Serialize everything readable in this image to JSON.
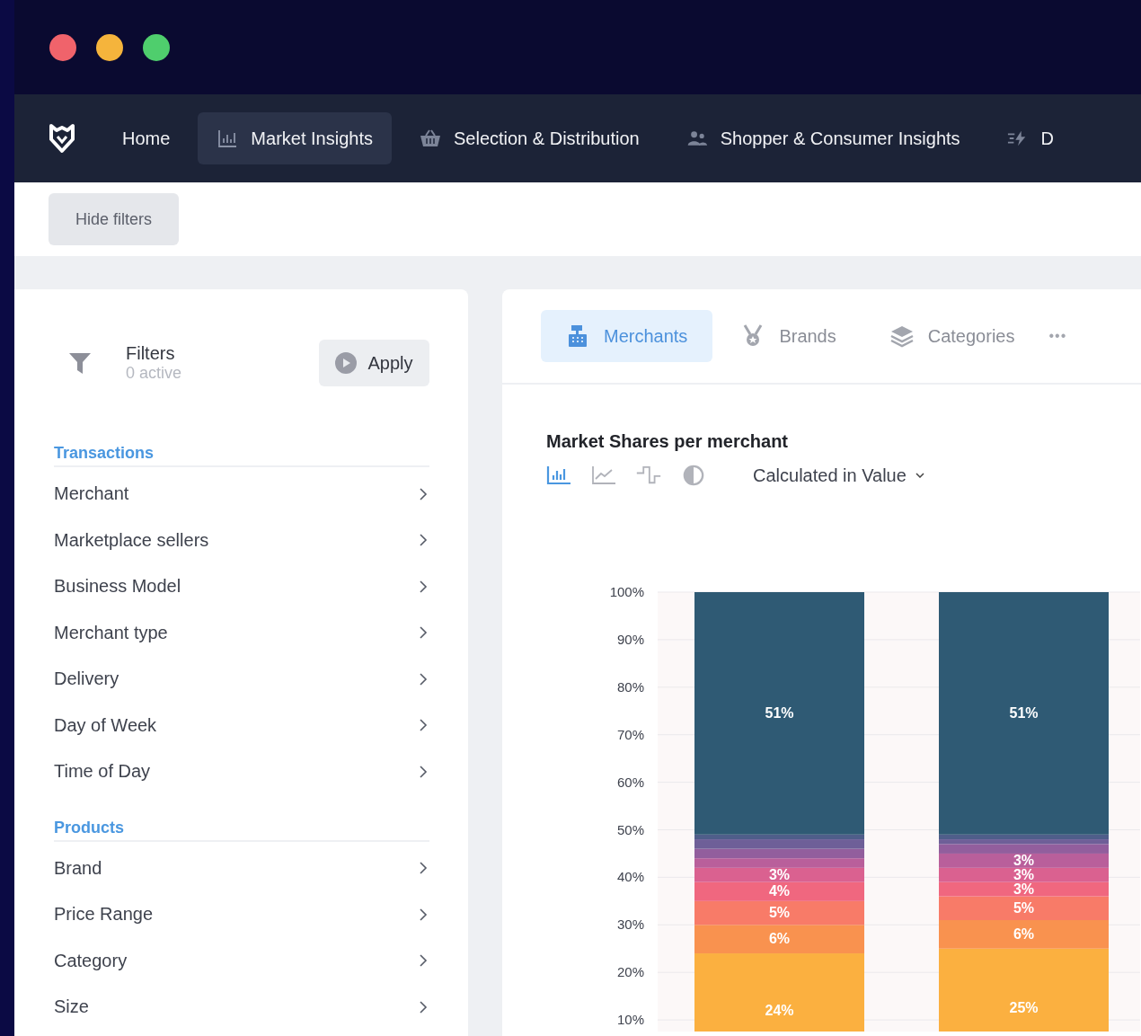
{
  "nav": {
    "items": [
      {
        "label": "Home",
        "selected": false
      },
      {
        "label": "Market Insights",
        "selected": true
      },
      {
        "label": "Selection & Distribution",
        "selected": false
      },
      {
        "label": "Shopper & Consumer Insights",
        "selected": false
      },
      {
        "label": "D",
        "selected": false
      }
    ]
  },
  "toolbar": {
    "hide_filters": "Hide filters"
  },
  "filters": {
    "title": "Filters",
    "count": "0 active",
    "apply": "Apply",
    "sections": [
      {
        "title": "Transactions",
        "items": [
          "Merchant",
          "Marketplace sellers",
          "Business Model",
          "Merchant type",
          "Delivery",
          "Day of Week",
          "Time of Day"
        ]
      },
      {
        "title": "Products",
        "items": [
          "Brand",
          "Price Range",
          "Category",
          "Size"
        ]
      }
    ]
  },
  "tabs": [
    {
      "label": "Merchants",
      "selected": true
    },
    {
      "label": "Brands",
      "selected": false
    },
    {
      "label": "Categories",
      "selected": false
    }
  ],
  "more_label": "•••",
  "panel": {
    "title": "Market Shares per merchant",
    "chart_types": [
      {
        "kind": "bar",
        "selected": true
      },
      {
        "kind": "line",
        "selected": false
      },
      {
        "kind": "step",
        "selected": false
      },
      {
        "kind": "contrast",
        "selected": false
      }
    ],
    "measure": "Calculated in Value",
    "chart_data": {
      "type": "bar",
      "stacked": true,
      "grid": true,
      "ylim": [
        0,
        100
      ],
      "yticks": [
        {
          "value": 10,
          "label": "10%"
        },
        {
          "value": 20,
          "label": "20%"
        },
        {
          "value": 30,
          "label": "30%"
        },
        {
          "value": 40,
          "label": "40%"
        },
        {
          "value": 50,
          "label": "50%"
        },
        {
          "value": 60,
          "label": "60%"
        },
        {
          "value": 70,
          "label": "70%"
        },
        {
          "value": 80,
          "label": "80%"
        },
        {
          "value": 90,
          "label": "90%"
        },
        {
          "value": 100,
          "label": "100%"
        }
      ],
      "series": [
        {
          "color": "#fbb040",
          "values": [
            24,
            25
          ],
          "value_labels": [
            "24%",
            "25%"
          ]
        },
        {
          "color": "#f9924f",
          "values": [
            6,
            6
          ],
          "value_labels": [
            "6%",
            "6%"
          ]
        },
        {
          "color": "#f87b68",
          "values": [
            5,
            5
          ],
          "value_labels": [
            "5%",
            "5%"
          ]
        },
        {
          "color": "#f0677f",
          "values": [
            4,
            3
          ],
          "value_labels": [
            "4%",
            "3%"
          ]
        },
        {
          "color": "#da6190",
          "values": [
            3,
            3
          ],
          "value_labels": [
            "3%",
            "3%"
          ]
        },
        {
          "color": "#b95f9b",
          "values": [
            2,
            3
          ],
          "value_labels": [
            null,
            "3%"
          ]
        },
        {
          "color": "#925e9d",
          "values": [
            2,
            2
          ],
          "value_labels": [
            null,
            null
          ]
        },
        {
          "color": "#6e5f98",
          "values": [
            2,
            1
          ],
          "value_labels": [
            null,
            null
          ]
        },
        {
          "color": "#4f5e8a",
          "values": [
            1,
            1
          ],
          "value_labels": [
            null,
            null
          ]
        },
        {
          "color": "#2f5a74",
          "values": [
            51,
            51
          ],
          "value_labels": [
            "51%",
            "51%"
          ]
        }
      ]
    }
  }
}
